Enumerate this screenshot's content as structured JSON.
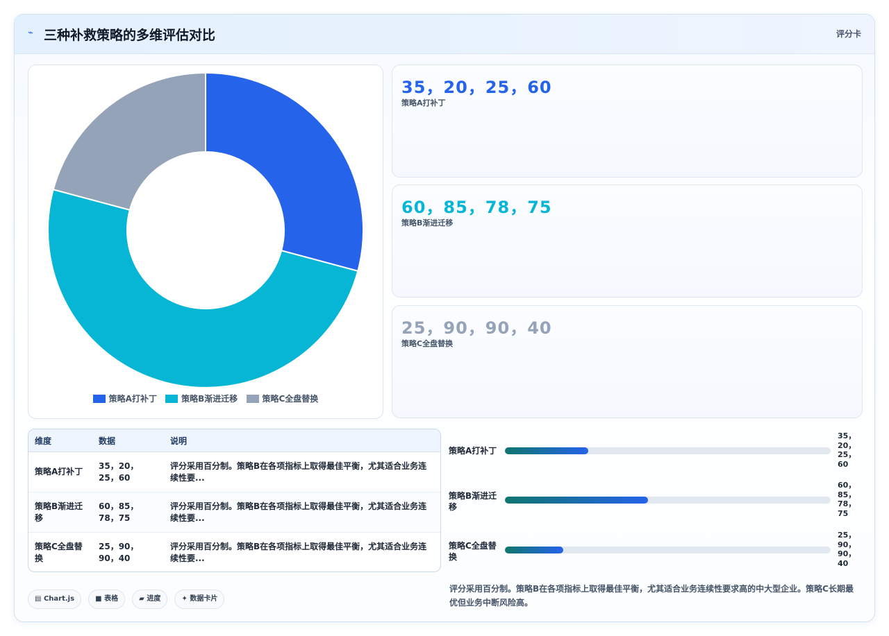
{
  "header": {
    "title": "三种补救策略的多维评估对比",
    "tag": "评分卡",
    "icon": "lightning-icon"
  },
  "chart_data": {
    "type": "pie",
    "variant": "doughnut",
    "categories": [
      "策略A打补丁",
      "策略B渐进迁移",
      "策略C全盘替换"
    ],
    "values": [
      35,
      60,
      25
    ],
    "colors": [
      "#2563eb",
      "#06b6d4",
      "#94a3b8"
    ],
    "legend_position": "bottom"
  },
  "stats": [
    {
      "value": "35，20，25，60",
      "label": "策略A打补丁",
      "color": "#2563eb"
    },
    {
      "value": "60，85，78，75",
      "label": "策略B渐进迁移",
      "color": "#06b6d4"
    },
    {
      "value": "25，90，90，40",
      "label": "策略C全盘替换",
      "color": "#94a3b8"
    }
  ],
  "table": {
    "headers": [
      "维度",
      "数据",
      "说明"
    ],
    "rows": [
      [
        "策略A打补丁",
        "35，20，25，60",
        "评分采用百分制。策略B在各项指标上取得最佳平衡，尤其适合业务连续性要..."
      ],
      [
        "策略B渐进迁移",
        "60，85，78，75",
        "评分采用百分制。策略B在各项指标上取得最佳平衡，尤其适合业务连续性要..."
      ],
      [
        "策略C全盘替换",
        "25，90，90，40",
        "评分采用百分制。策略B在各项指标上取得最佳平衡，尤其适合业务连续性要..."
      ]
    ]
  },
  "progress": [
    {
      "label": "策略A打补丁",
      "value": "35，20，25，60",
      "percent": 25.5
    },
    {
      "label": "策略B渐进迁移",
      "value": "60，85，78，75",
      "percent": 44
    },
    {
      "label": "策略C全盘替换",
      "value": "25，90，90，40",
      "percent": 18
    }
  ],
  "note": "评分采用百分制。策略B在各项指标上取得最佳平衡，尤其适合业务连续性要求高的中大型企业。策略C长期最优但业务中断风险高。",
  "chips": [
    {
      "icon": "chart-icon",
      "glyph": "▤",
      "label": "Chart.js"
    },
    {
      "icon": "table-icon",
      "glyph": "■",
      "label": "表格"
    },
    {
      "icon": "progress-icon",
      "glyph": "▰",
      "label": "进度"
    },
    {
      "icon": "sparkle-icon",
      "glyph": "✦",
      "label": "数据卡片"
    }
  ]
}
